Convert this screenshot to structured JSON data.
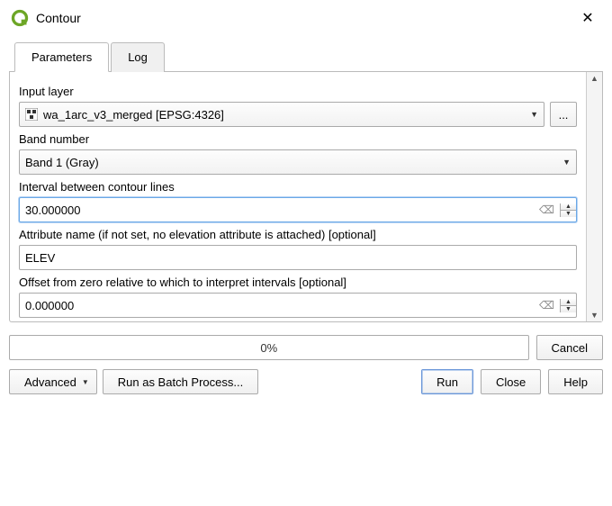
{
  "window": {
    "title": "Contour",
    "close_icon": "✕"
  },
  "tabs": {
    "parameters": "Parameters",
    "log": "Log",
    "active": "parameters"
  },
  "fields": {
    "input_layer": {
      "label": "Input layer",
      "value": "wa_1arc_v3_merged [EPSG:4326]",
      "browse": "..."
    },
    "band_number": {
      "label": "Band number",
      "value": "Band 1 (Gray)"
    },
    "interval": {
      "label": "Interval between contour lines",
      "value": "30.000000"
    },
    "attribute_name": {
      "label": "Attribute name (if not set, no elevation attribute is attached) [optional]",
      "value": "ELEV"
    },
    "offset": {
      "label": "Offset from zero relative to which to interpret intervals [optional]",
      "value": "0.000000"
    }
  },
  "progress": {
    "text": "0%"
  },
  "buttons": {
    "cancel": "Cancel",
    "advanced": "Advanced",
    "batch": "Run as Batch Process...",
    "run": "Run",
    "close": "Close",
    "help": "Help"
  },
  "icons": {
    "clear": "⌫",
    "dropdown": "▼",
    "up": "▲",
    "down": "▼"
  }
}
